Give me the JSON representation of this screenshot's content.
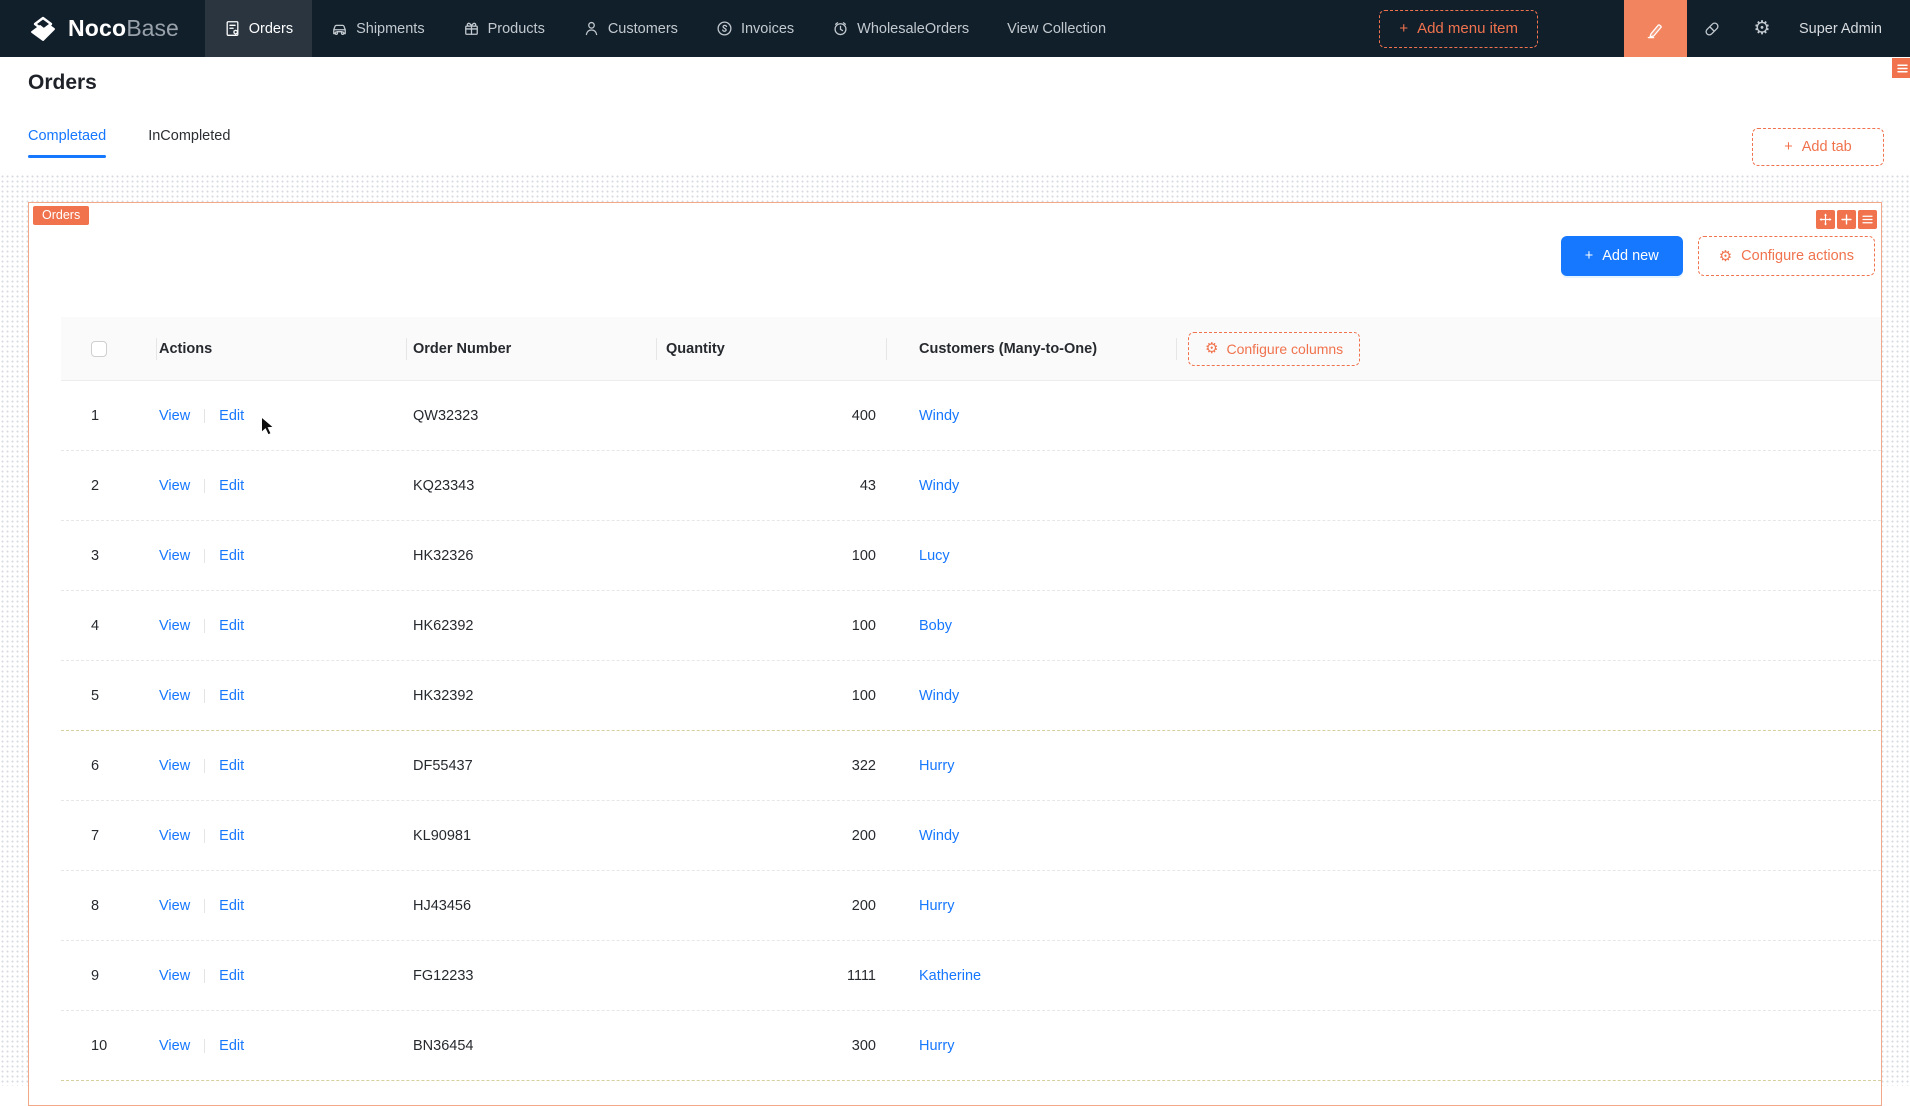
{
  "colors": {
    "accent_orange": "#f0734e",
    "primary_blue": "#1677ff",
    "navbar_bg": "#111f2b",
    "link_blue": "#1677ff"
  },
  "glyphs": {
    "plus": "+",
    "gear": "⚙"
  },
  "navbar": {
    "logo": {
      "noco": "Noco",
      "base": "Base"
    },
    "items": [
      {
        "label": "Orders",
        "icon": "orders-icon",
        "active": true
      },
      {
        "label": "Shipments",
        "icon": "shipments-icon",
        "active": false
      },
      {
        "label": "Products",
        "icon": "products-icon",
        "active": false
      },
      {
        "label": "Customers",
        "icon": "customers-icon",
        "active": false
      },
      {
        "label": "Invoices",
        "icon": "invoices-icon",
        "active": false
      },
      {
        "label": "WholesaleOrders",
        "icon": "wholesale-orders-icon",
        "active": false
      },
      {
        "label": "View Collection",
        "icon": "",
        "active": false
      }
    ],
    "add_menu_item_label": "Add menu item",
    "user": "Super Admin"
  },
  "page": {
    "title": "Orders",
    "tabs": [
      {
        "label": "Completaed",
        "active": true
      },
      {
        "label": "InCompleted",
        "active": false
      }
    ],
    "add_tab_label": "Add tab"
  },
  "block": {
    "badge": "Orders",
    "add_new_label": "Add new",
    "configure_actions_label": "Configure actions",
    "table": {
      "headers": {
        "actions": "Actions",
        "order_number": "Order Number",
        "quantity": "Quantity",
        "customers": "Customers (Many-to-One)"
      },
      "configure_columns_label": "Configure columns",
      "row_actions": {
        "view": "View",
        "edit": "Edit"
      },
      "rows": [
        {
          "index": "1",
          "order_number": "QW32323",
          "quantity": "400",
          "customer": "Windy"
        },
        {
          "index": "2",
          "order_number": "KQ23343",
          "quantity": "43",
          "customer": "Windy"
        },
        {
          "index": "3",
          "order_number": "HK32326",
          "quantity": "100",
          "customer": "Lucy"
        },
        {
          "index": "4",
          "order_number": "HK62392",
          "quantity": "100",
          "customer": "Boby"
        },
        {
          "index": "5",
          "order_number": "HK32392",
          "quantity": "100",
          "customer": "Windy"
        },
        {
          "index": "6",
          "order_number": "DF55437",
          "quantity": "322",
          "customer": "Hurry"
        },
        {
          "index": "7",
          "order_number": "KL90981",
          "quantity": "200",
          "customer": "Windy"
        },
        {
          "index": "8",
          "order_number": "HJ43456",
          "quantity": "200",
          "customer": "Hurry"
        },
        {
          "index": "9",
          "order_number": "FG12233",
          "quantity": "1111",
          "customer": "Katherine"
        },
        {
          "index": "10",
          "order_number": "BN36454",
          "quantity": "300",
          "customer": "Hurry"
        }
      ]
    }
  }
}
